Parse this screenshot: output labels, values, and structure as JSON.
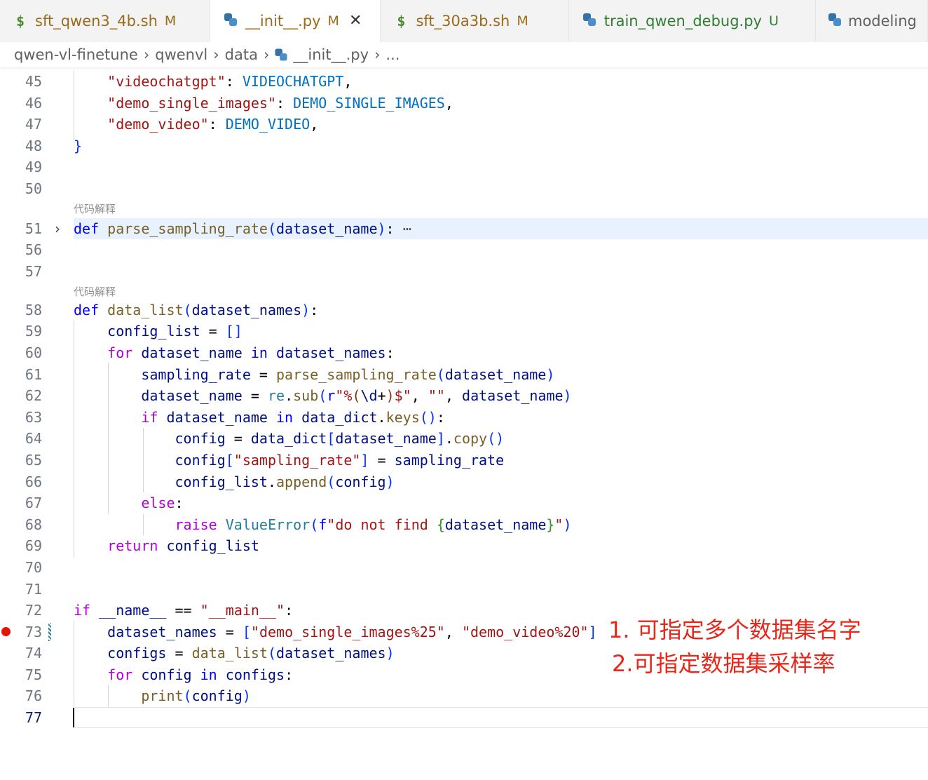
{
  "tabs": [
    {
      "icon": "shell-icon",
      "name": "sft_qwen3_4b.sh",
      "badge": "M",
      "status": "modified"
    },
    {
      "icon": "python-icon",
      "name": "__init__.py",
      "badge": "M",
      "status": "modified",
      "active": true
    },
    {
      "icon": "shell-icon",
      "name": "sft_30a3b.sh",
      "badge": "M",
      "status": "modified"
    },
    {
      "icon": "python-icon",
      "name": "train_qwen_debug.py",
      "badge": "U",
      "status": "untracked"
    },
    {
      "icon": "python-icon",
      "name": "modeling",
      "badge": "",
      "status": "plain"
    }
  ],
  "breadcrumb": [
    "qwen-vl-finetune",
    "qwenvl",
    "data",
    "__init__.py",
    "..."
  ],
  "codelens": "代码解释",
  "line_numbers": [
    "45",
    "46",
    "47",
    "48",
    "49",
    "50",
    "51",
    "56",
    "57",
    "58",
    "59",
    "60",
    "61",
    "62",
    "63",
    "64",
    "65",
    "66",
    "67",
    "68",
    "69",
    "70",
    "71",
    "72",
    "73",
    "74",
    "75",
    "76",
    "77"
  ],
  "annotation": {
    "line1": "1. 可指定多个数据集名字",
    "line2": "2.可指定数据集采样率"
  }
}
